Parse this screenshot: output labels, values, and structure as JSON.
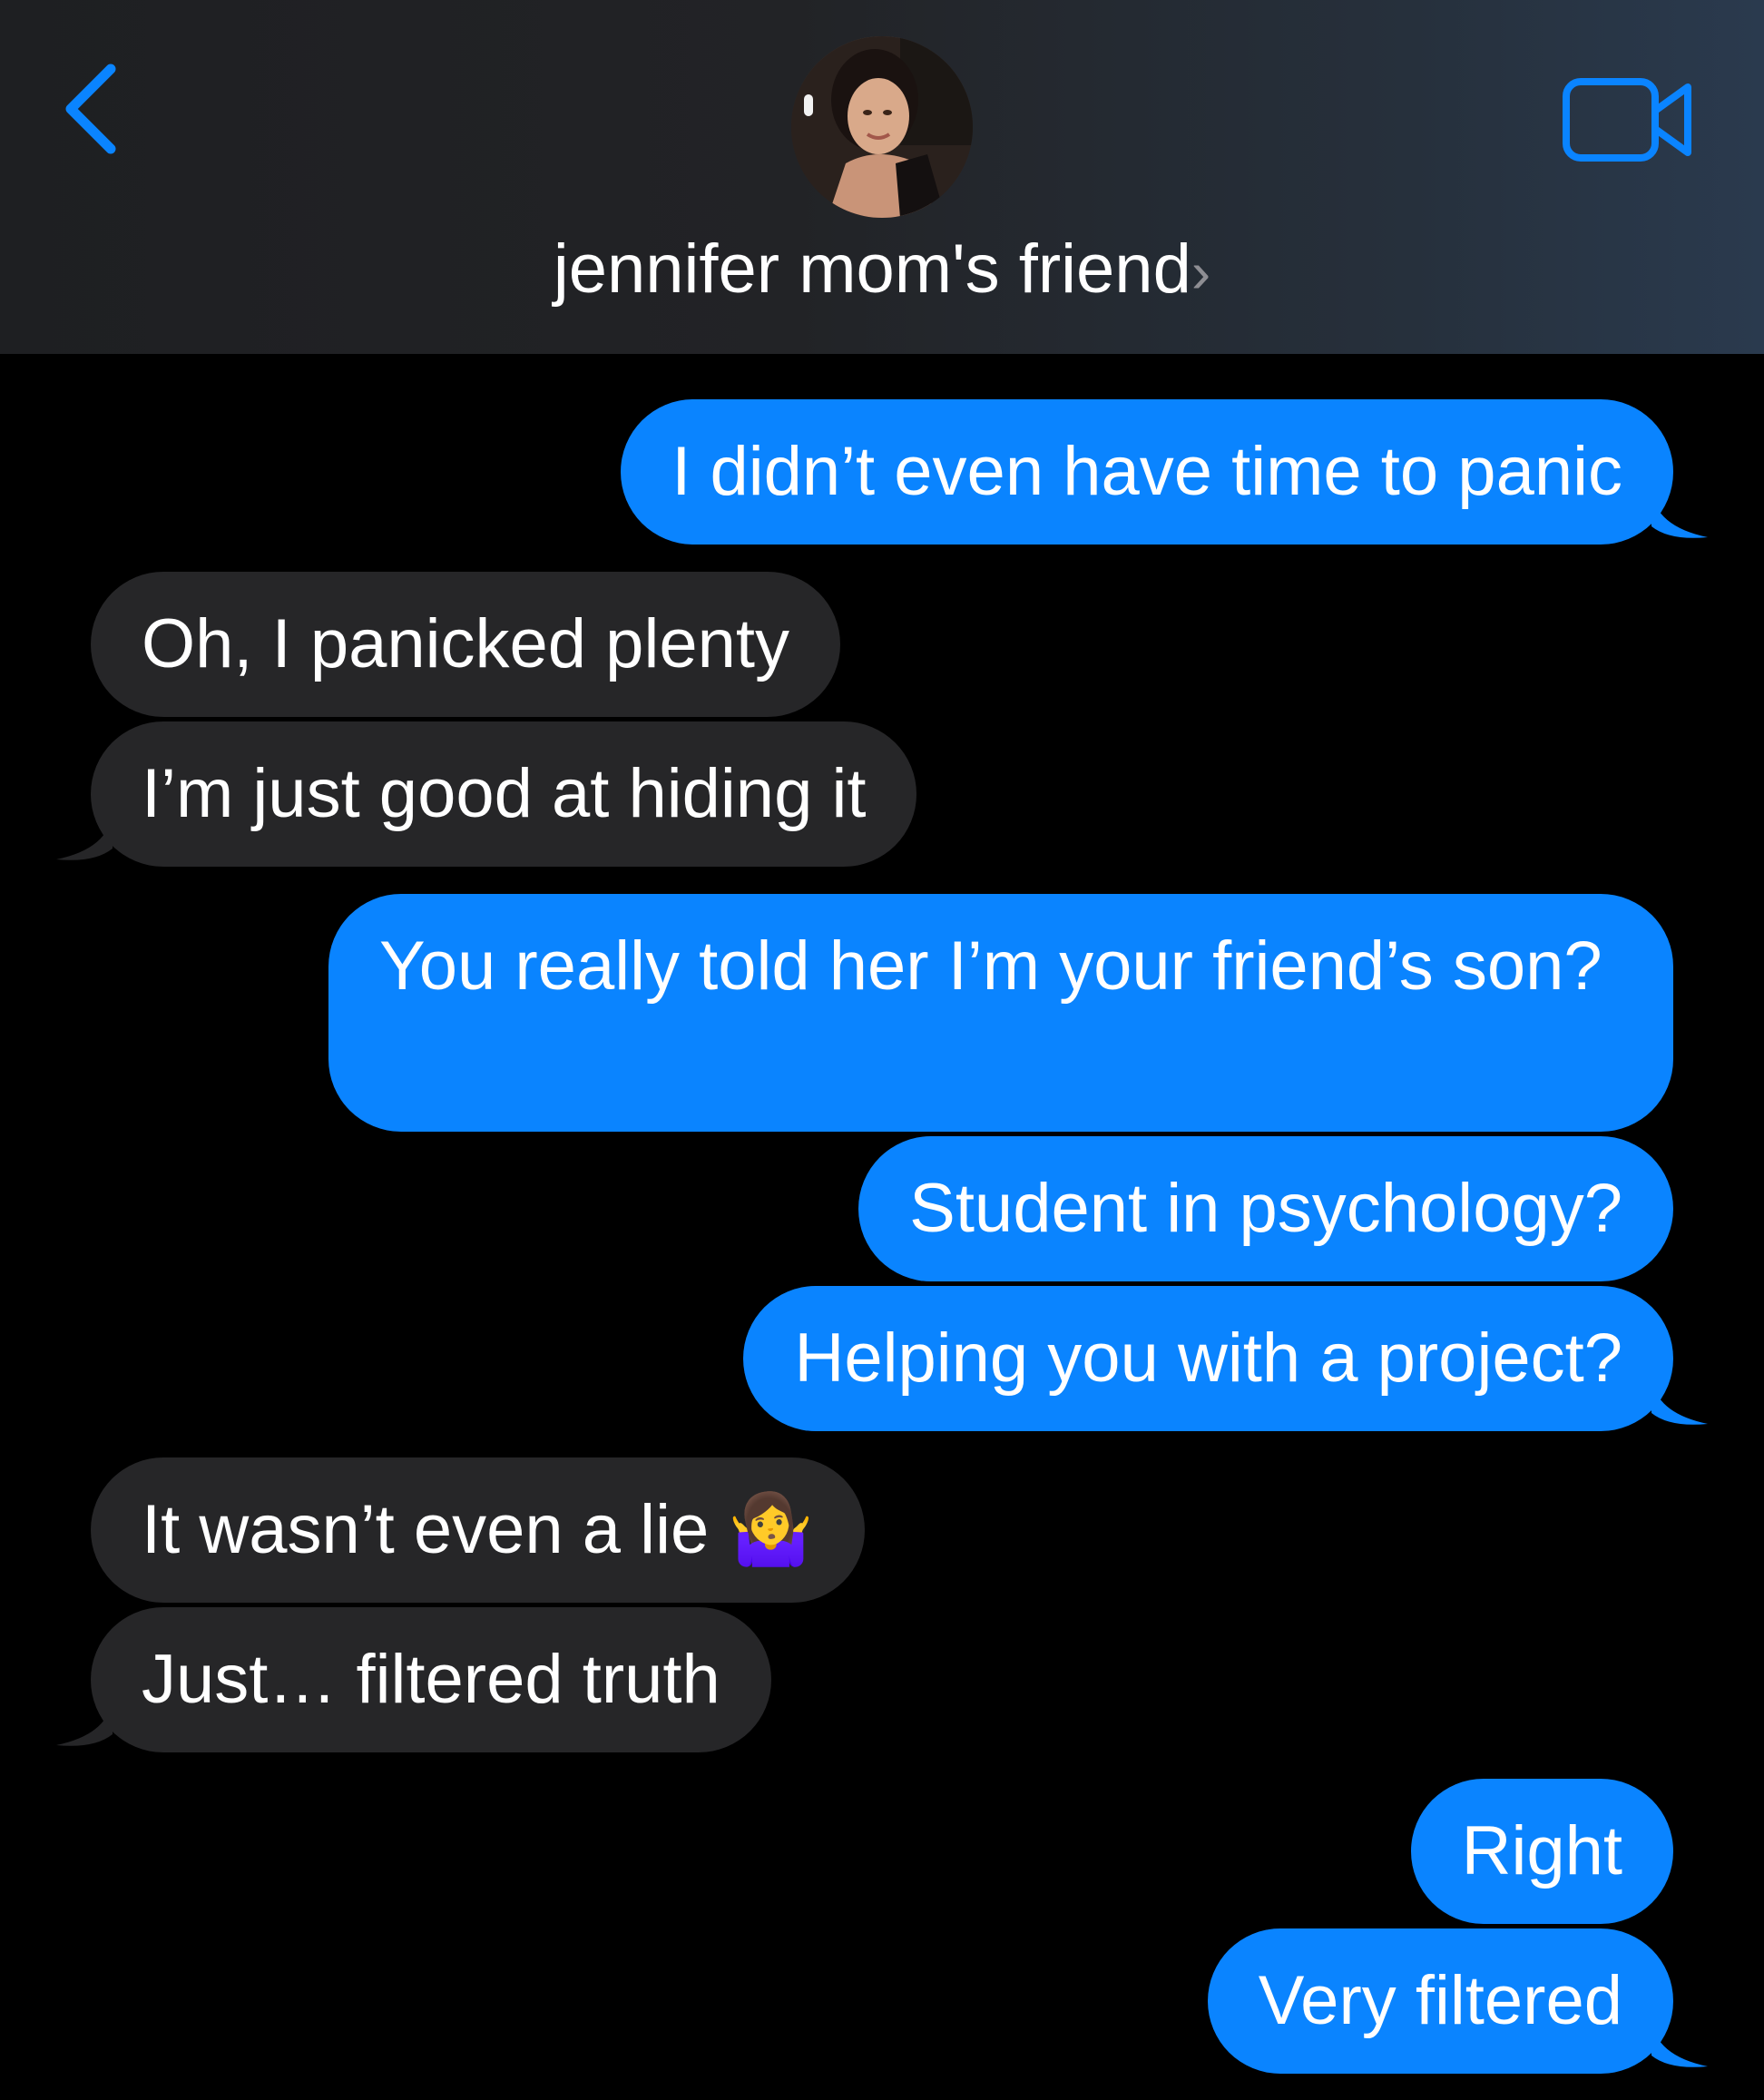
{
  "header": {
    "contact_name": "jennifer mom's friend",
    "chevron": "›",
    "back_icon": "chevron-left-icon",
    "video_icon": "video-camera-icon",
    "accent": "#0a84ff"
  },
  "messages": [
    {
      "from": "me",
      "text": "I didn’t even have time to panic"
    },
    {
      "from": "them",
      "text": "Oh, I panicked plenty"
    },
    {
      "from": "them",
      "text": "I’m just good at hiding it"
    },
    {
      "from": "me",
      "text": "You really told her I’m your friend’s son?"
    },
    {
      "from": "me",
      "text": "Student in psychology?"
    },
    {
      "from": "me",
      "text": "Helping you with a project?"
    },
    {
      "from": "them",
      "text": "It wasn’t even a lie 🤷‍♀️"
    },
    {
      "from": "them",
      "text": "Just… filtered truth"
    },
    {
      "from": "me",
      "text": "Right"
    },
    {
      "from": "me",
      "text": "Very filtered"
    }
  ],
  "colors": {
    "sent_bubble": "#0a84ff",
    "received_bubble": "#262628",
    "background": "#000000"
  }
}
